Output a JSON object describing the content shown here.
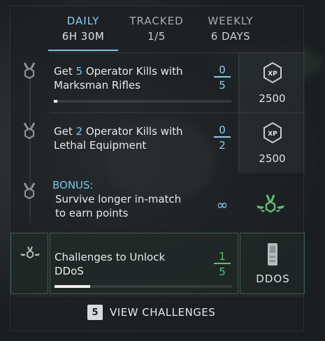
{
  "tabs": [
    {
      "label": "DAILY",
      "sub": "6H 30M"
    },
    {
      "label": "TRACKED",
      "sub": "1/5"
    },
    {
      "label": "WEEKLY",
      "sub": "6 DAYS"
    }
  ],
  "challenges": [
    {
      "line1_pre": "Get ",
      "line1_num": "5",
      "line1_post": " Operator Kills with",
      "line2": "Marksman Rifles",
      "current": "0",
      "total": "5",
      "progress": 0.02,
      "reward_icon": "xp-hexagon-icon",
      "reward_text": "XP",
      "reward_value": "2500"
    },
    {
      "line1_pre": "Get ",
      "line1_num": "2",
      "line1_post": " Operator Kills with",
      "line2": "Lethal Equipment",
      "current": "0",
      "total": "2",
      "progress": 0.02,
      "reward_icon": "xp-hexagon-icon",
      "reward_text": "XP",
      "reward_value": "2500"
    }
  ],
  "bonus": {
    "label": "BONUS:",
    "line1": "Survive longer in-match",
    "line2": "to earn points",
    "value": "∞",
    "reward_icon": "winged-medal-icon"
  },
  "unlock": {
    "line1": "Challenges to Unlock",
    "line2": "DDoS",
    "current": "1",
    "total": "5",
    "progress": 0.2,
    "reward_icon": "ddos-device-icon",
    "reward_label": "DDOS"
  },
  "footer": {
    "count": "5",
    "label": "VIEW CHALLENGES"
  },
  "colors": {
    "accent_blue": "#7cc4ea",
    "accent_green": "#5fbf78"
  }
}
